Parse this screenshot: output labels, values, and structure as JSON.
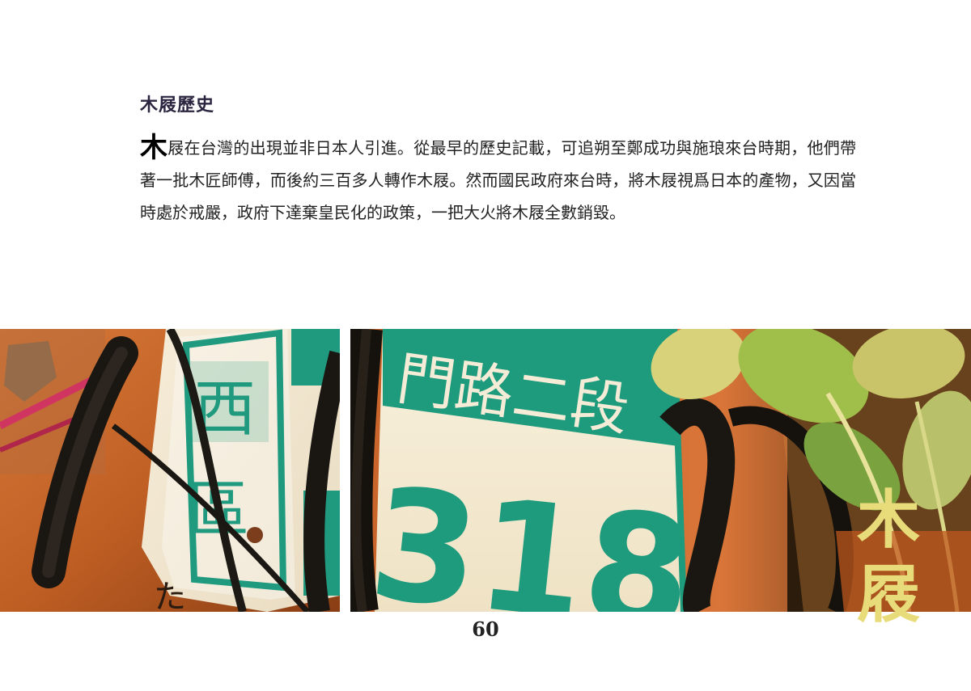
{
  "heading": "木屐歷史",
  "paragraph": {
    "dropcap": "木",
    "text": "屐在台灣的出現並非日本人引進。從最早的歷史記載，可追朔至鄭成功與施琅來台時期，他們帶著一批木匠師傅，而後約三百多人轉作木屐。然而國民政府來台時，將木屐視爲日本的產物，又因當時處於戒嚴，政府下達棄皇民化的政策，一把大火將木屐全數銷毀。"
  },
  "photos": {
    "left": {
      "sign_chars": [
        "西",
        "區"
      ],
      "scribble": "た"
    },
    "right": {
      "street_text": "門路二段",
      "house_number": "318"
    }
  },
  "page_number": "60",
  "vertical_title": [
    "木",
    "屐"
  ]
}
